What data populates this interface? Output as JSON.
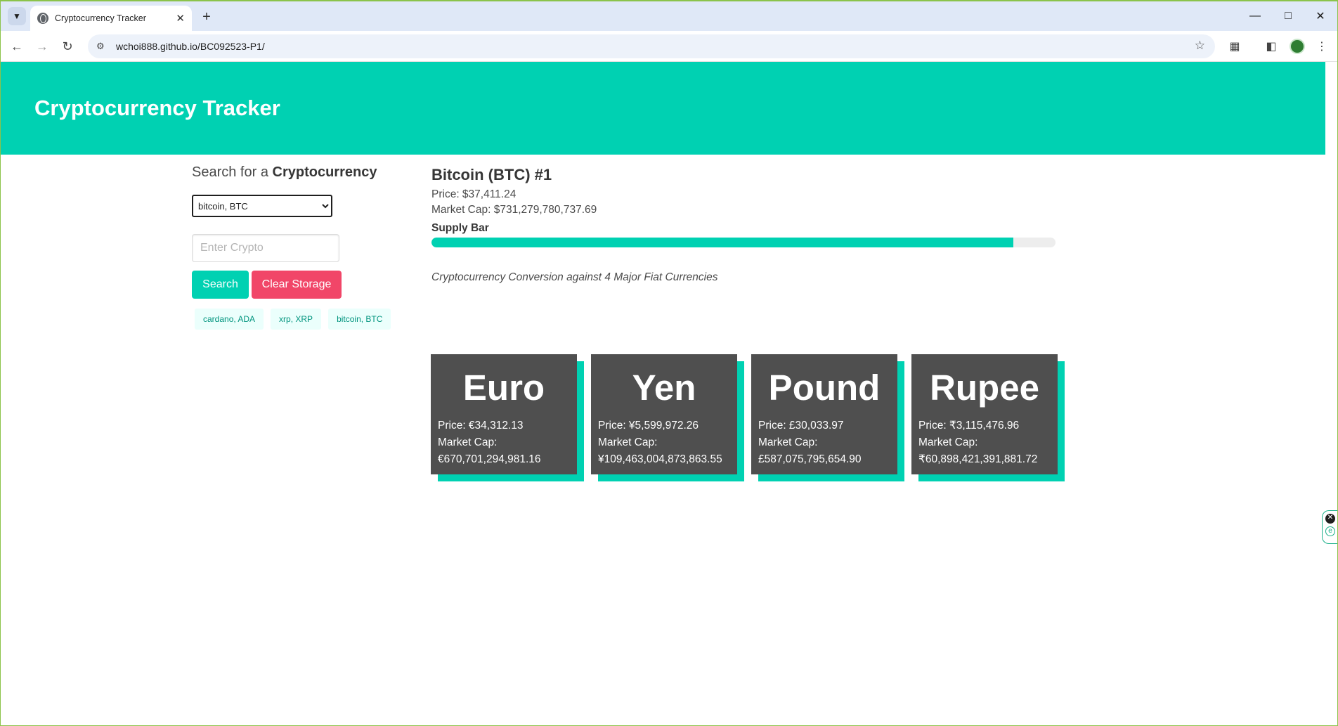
{
  "browser": {
    "tab_title": "Cryptocurrency Tracker",
    "tab_close": "✕",
    "new_tab": "+",
    "url": "wchoi888.github.io/BC092523-P1/"
  },
  "header": {
    "title": "Cryptocurrency Tracker"
  },
  "search": {
    "heading_prefix": "Search for a ",
    "heading_bold": "Cryptocurrency",
    "select_value": "bitcoin, BTC",
    "input_placeholder": "Enter Crypto",
    "search_label": "Search",
    "clear_label": "Clear Storage",
    "history": [
      "cardano, ADA",
      "xrp, XRP",
      "bitcoin, BTC"
    ]
  },
  "coin": {
    "title": "Bitcoin (BTC) #1",
    "price": "Price: $37,411.24",
    "market_cap": "Market Cap: $731,279,780,737.69",
    "supply_label": "Supply Bar",
    "supply_fraction": 0.932
  },
  "conversion": {
    "caption": "Cryptocurrency Conversion against 4 Major Fiat Currencies",
    "cards": [
      {
        "name": "Euro",
        "price": "Price: €34,312.13",
        "cap_label": "Market Cap:",
        "cap_value": "€670,701,294,981.16"
      },
      {
        "name": "Yen",
        "price": "Price: ¥5,599,972.26",
        "cap_label": "Market Cap:",
        "cap_value": "¥109,463,004,873,863.55"
      },
      {
        "name": "Pound",
        "price": "Price: £30,033.97",
        "cap_label": "Market Cap:",
        "cap_value": "£587,075,795,654.90"
      },
      {
        "name": "Rupee",
        "price": "Price: ₹3,115,476.96",
        "cap_label": "Market Cap:",
        "cap_value": "₹60,898,421,391,881.72"
      }
    ]
  },
  "colors": {
    "primary": "#00d1b2",
    "danger": "#f14668",
    "card": "#4f4f4f"
  }
}
